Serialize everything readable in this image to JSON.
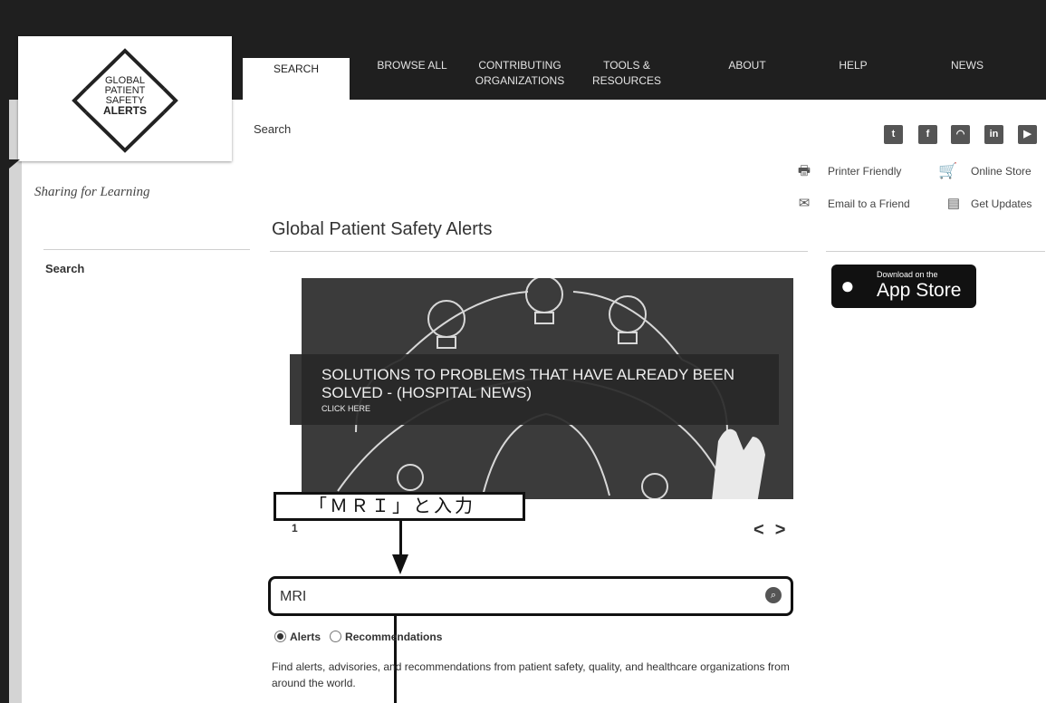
{
  "logo": {
    "lines": [
      "GLOBAL",
      "PATIENT",
      "SAFETY",
      "ALERTS"
    ]
  },
  "tagline": "Sharing for Learning",
  "nav": {
    "items": [
      {
        "label": "SEARCH"
      },
      {
        "label": "BROWSE ALL"
      },
      {
        "label": "CONTRIBUTING\nORGANIZATIONS"
      },
      {
        "label": "TOOLS &\nRESOURCES"
      },
      {
        "label": "ABOUT"
      },
      {
        "label": "HELP"
      },
      {
        "label": "NEWS"
      }
    ]
  },
  "breadcrumb": "Search",
  "social": [
    "twitter-icon",
    "facebook-icon",
    "rss-icon",
    "linkedin-icon",
    "youtube-icon"
  ],
  "utility": {
    "printer": "Printer Friendly",
    "store": "Online Store",
    "email": "Email to a Friend",
    "updates": "Get Updates"
  },
  "page_title": "Global Patient Safety Alerts",
  "sidebar": {
    "search": "Search"
  },
  "appstore": {
    "small": "Download on the",
    "big": "App Store"
  },
  "slide": {
    "headline": "SOLUTIONS TO PROBLEMS THAT HAVE ALREADY BEEN SOLVED - (HOSPITAL NEWS)",
    "sub": "CLICK HERE",
    "number": "1",
    "prev": "<",
    "next": ">"
  },
  "search": {
    "value": "MRI"
  },
  "radios": {
    "alerts": "Alerts",
    "recommendations": "Recommendations"
  },
  "description": "Find alerts, advisories, and recommendations from patient safety, quality, and healthcare organizations from around the world.",
  "annotation": {
    "callout": "「ＭＲＩ」と入力"
  }
}
